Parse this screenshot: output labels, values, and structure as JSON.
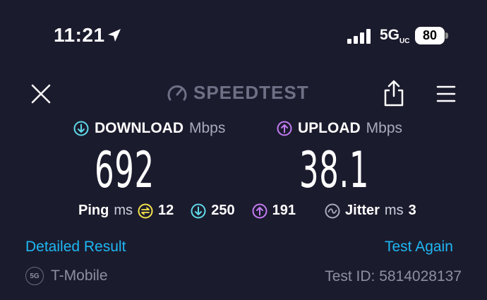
{
  "status_bar": {
    "time": "11:21",
    "network": "5G",
    "network_suffix": "UC",
    "battery": "80"
  },
  "header": {
    "brand": "SPEEDTEST",
    "icons": [
      "close-icon",
      "speedometer-icon",
      "share-icon",
      "menu-icon"
    ]
  },
  "download": {
    "label": "DOWNLOAD",
    "unit": "Mbps",
    "value": "692"
  },
  "upload": {
    "label": "UPLOAD",
    "unit": "Mbps",
    "value": "38.1"
  },
  "ping": {
    "label": "Ping",
    "unit": "ms",
    "idle": "12",
    "download": "250",
    "upload": "191"
  },
  "jitter": {
    "label": "Jitter",
    "unit": "ms",
    "value": "3"
  },
  "actions": {
    "detailed": "Detailed Result",
    "again": "Test Again"
  },
  "footer": {
    "badge": "5G",
    "provider": "T-Mobile",
    "test_id": "Test ID: 5814028137"
  },
  "colors": {
    "background": "#1b1b2e",
    "download": "#5fd9e8",
    "upload": "#c27bf2",
    "idle": "#f5e44a",
    "link": "#1fb7f2"
  }
}
